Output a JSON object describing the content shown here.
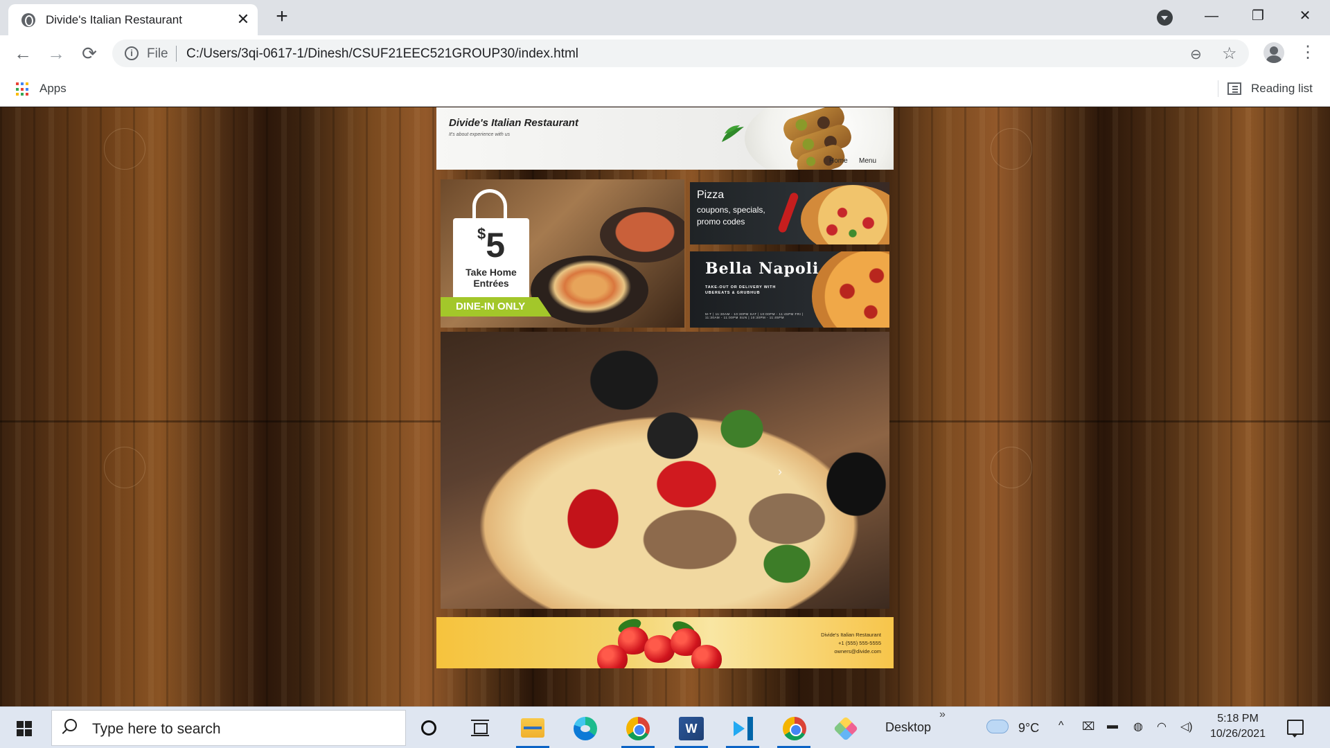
{
  "browser": {
    "tab": {
      "title": "Divide's Italian Restaurant",
      "close_label": "✕",
      "favicon": "globe-icon"
    },
    "new_tab_label": "+",
    "window_controls": {
      "minimize": "—",
      "restore": "❐",
      "close": "✕"
    },
    "nav": {
      "back": "←",
      "forward": "→",
      "reload": "⟳"
    },
    "omnibox": {
      "info_icon": "i",
      "scheme": "File",
      "url": "C:/Users/3qi-0617-1/Dinesh/CSUF21EEC521GROUP30/index.html",
      "zoom_icon": "zoom-out-icon",
      "bookmark_icon": "star-icon"
    },
    "menu_label": "⋮",
    "bookmarks_bar": {
      "apps_label": "Apps",
      "reading_list_label": "Reading list",
      "apps_colors": [
        "#ea4335",
        "#4285f4",
        "#fbbc05",
        "#34a853",
        "#ea4335",
        "#4285f4",
        "#fbbc05",
        "#34a853",
        "#ea4335"
      ]
    }
  },
  "site": {
    "header": {
      "brand": "Divide's Italian Restaurant",
      "tagline": "It's about experience with us",
      "nav": [
        "Home",
        "Menu"
      ]
    },
    "promos": {
      "takehome": {
        "price_currency": "$",
        "price": "5",
        "label_line1": "Take Home",
        "label_line2": "Entrées",
        "badge": "DINE-IN ONLY"
      },
      "pizza": {
        "title": "Pizza",
        "subtitle": "coupons, specials, promo codes"
      },
      "bella": {
        "title": "Bella Napoli",
        "subtitle": "TAKE-OUT OR DELIVERY WITH UBEREATS & GRUBHUB",
        "hours": "M-T | 11:30AM - 10:30PM    SAT | 10:00PM - 11:45PM    FRI | 11:30AM - 11:00PM    SUN | 10:30PM - 11:45PM"
      }
    },
    "hero": {
      "next_label": "›"
    },
    "footer": {
      "name": "Divide's Italian Restaurant",
      "phone": "+1 (555) 555-5555",
      "email": "owners@divide.com"
    }
  },
  "taskbar": {
    "search_placeholder": "Type here to search",
    "word_letter": "W",
    "desktop_label": "Desktop",
    "overflow_label": "»",
    "temperature": "9°C",
    "tray": {
      "chevron": "^",
      "time": "5:18 PM",
      "date": "10/26/2021"
    },
    "underline_color": "#0b63c5"
  }
}
